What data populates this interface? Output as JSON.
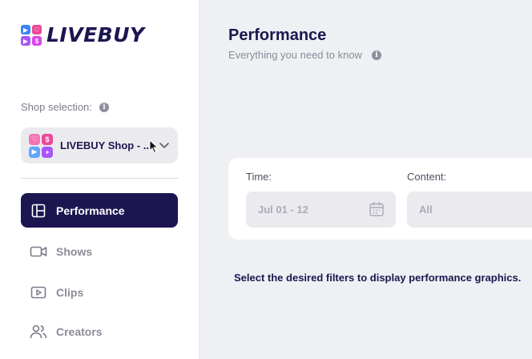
{
  "brand": {
    "name": "LIVEBUY"
  },
  "sidebar": {
    "shop_label": "Shop selection:",
    "shop_name": "LIVEBUY Shop - ...",
    "nav": [
      {
        "label": "Performance",
        "icon": "layout-icon",
        "active": true
      },
      {
        "label": "Shows",
        "icon": "video-camera-icon",
        "active": false
      },
      {
        "label": "Clips",
        "icon": "play-icon",
        "active": false
      },
      {
        "label": "Creators",
        "icon": "users-icon",
        "active": false
      }
    ]
  },
  "main": {
    "title": "Performance",
    "subtitle": "Everything you need to know",
    "filters": {
      "time_label": "Time:",
      "time_value": "Jul 01 - 12",
      "content_label": "Content:",
      "content_value": "All"
    },
    "hint": "Select the desired filters to display performance graphics."
  },
  "colors": {
    "primary": "#1c1650",
    "background": "#eff0f3",
    "muted": "#8a8c99"
  }
}
